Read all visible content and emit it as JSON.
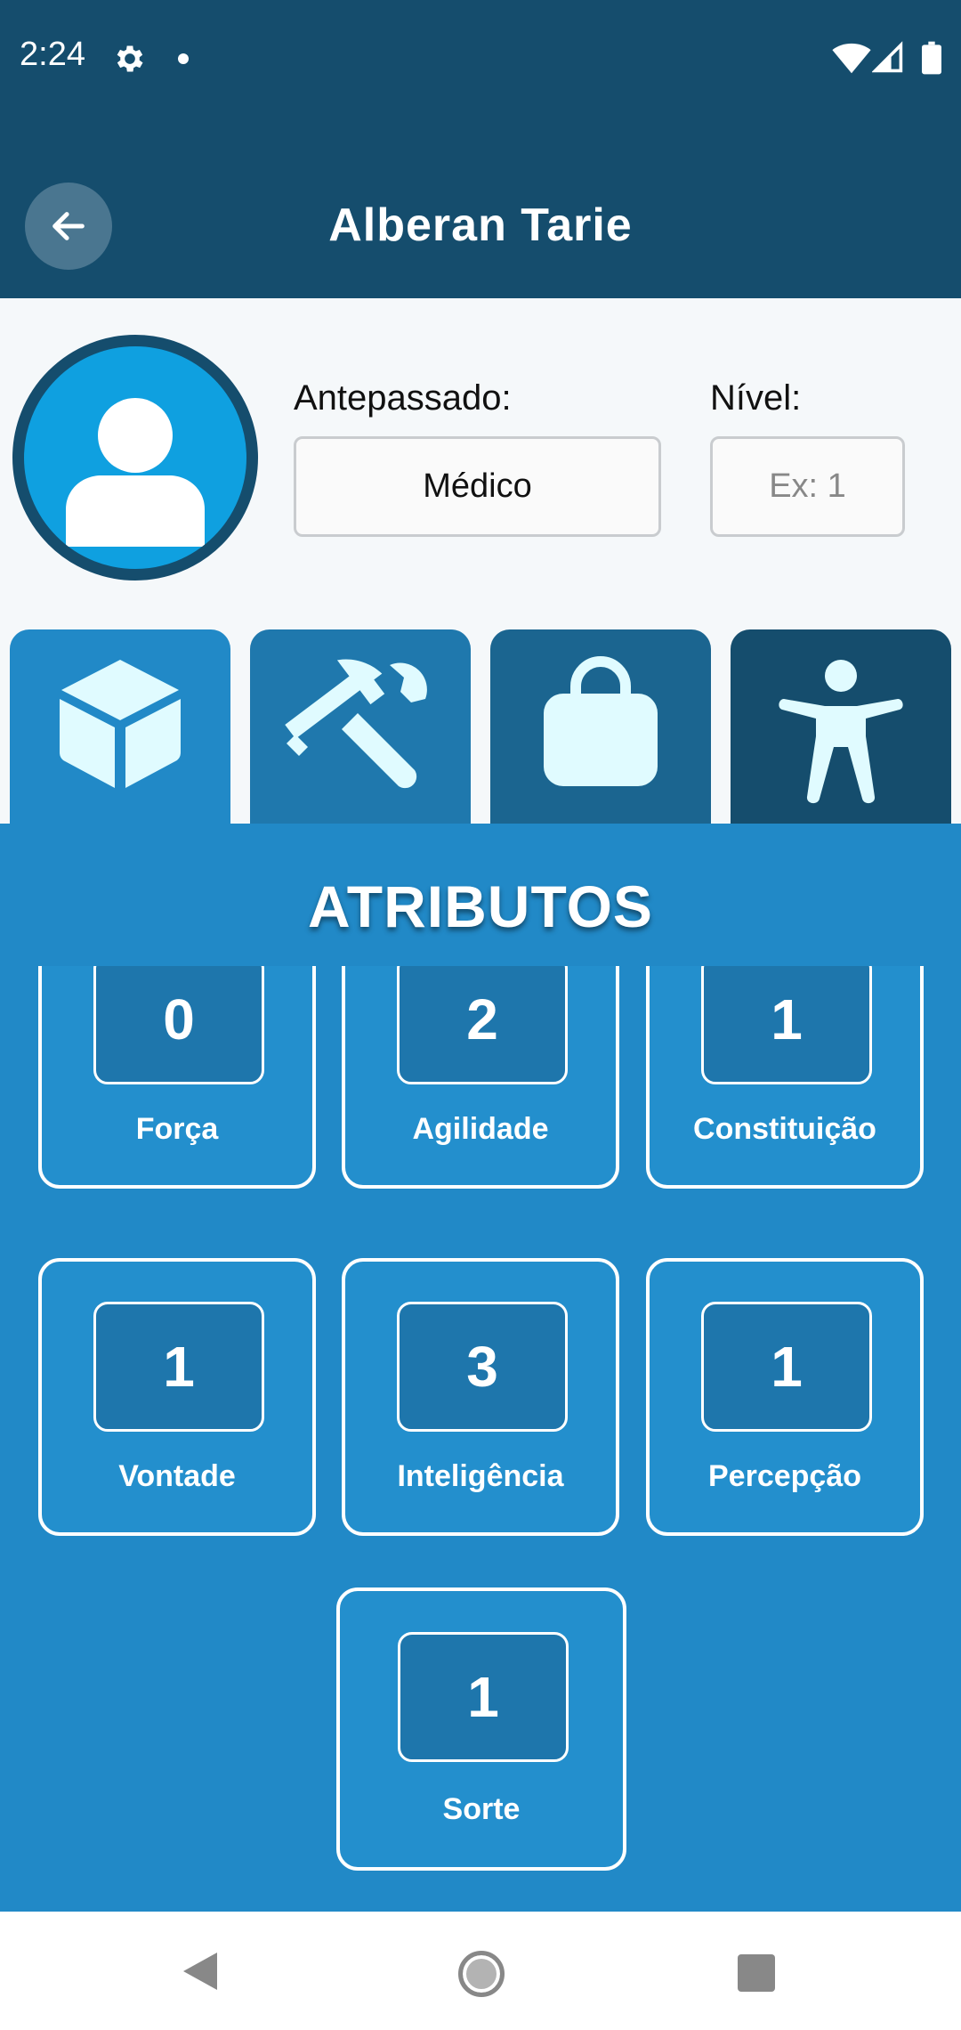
{
  "status_bar": {
    "time": "2:24",
    "icons": [
      "gear-icon",
      "notification-dot",
      "wifi-icon",
      "signal-icon",
      "battery-icon"
    ]
  },
  "app_bar": {
    "back_icon": "arrow-left-icon",
    "title": "Alberan Tarie"
  },
  "profile": {
    "avatar_icon": "person-icon",
    "ancestor_label": "Antepassado:",
    "ancestor_value": "Médico",
    "level_label": "Nível:",
    "level_placeholder": "Ex: 1"
  },
  "tabs": [
    {
      "icon": "cube-icon"
    },
    {
      "icon": "hammer-wrench-icon"
    },
    {
      "icon": "bag-icon"
    },
    {
      "icon": "person-arms-out-icon"
    }
  ],
  "panel": {
    "title": "ATRIBUTOS"
  },
  "attributes": [
    {
      "name": "Força",
      "value": "0"
    },
    {
      "name": "Agilidade",
      "value": "2"
    },
    {
      "name": "Constituição",
      "value": "1"
    },
    {
      "name": "Vontade",
      "value": "1"
    },
    {
      "name": "Inteligência",
      "value": "3"
    },
    {
      "name": "Percepção",
      "value": "1"
    },
    {
      "name": "Sorte",
      "value": "1"
    }
  ],
  "colors": {
    "primary_dark": "#154d6d",
    "primary": "#2189c7",
    "accent_icon": "#e0fbff"
  }
}
